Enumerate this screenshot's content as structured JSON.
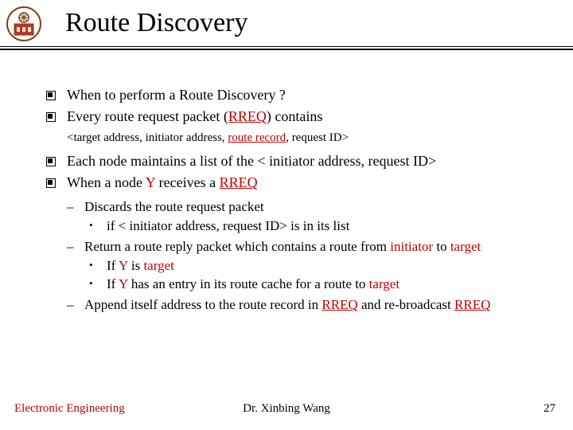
{
  "title": "Route Discovery",
  "bullets": {
    "b1": "When to perform a Route Discovery ?",
    "b2_pre": "Every route request packet (",
    "b2_rreq": "RREQ",
    "b2_post": ") contains",
    "b2_sub_pre": "<target address, initiator address, ",
    "b2_sub_rr": "route record",
    "b2_sub_post": ", request ID>",
    "b3": "Each node maintains a list of the < initiator address,  request ID>",
    "b4_pre": "When a node ",
    "b4_y": "Y",
    "b4_mid": " receives a ",
    "b4_rreq": "RREQ"
  },
  "dash": {
    "d1": "Discards the route request packet",
    "d1_dot": "if < initiator address,  request ID> is in its list",
    "d2_pre": "Return a route reply packet which contains a route from ",
    "d2_init": "initiator",
    "d2_mid": " to ",
    "d2_tgt": "target",
    "d2_dot1_pre": "If  ",
    "d2_dot1_y": "Y",
    "d2_dot1_post": " is ",
    "d2_dot1_tgt": "target",
    "d2_dot2_pre": "If ",
    "d2_dot2_y": "Y",
    "d2_dot2_mid": " has an entry in its route cache for a route to ",
    "d2_dot2_tgt": "target",
    "d3_pre": "Append itself address to the route record in ",
    "d3_r1": "RREQ",
    "d3_mid": " and re-broadcast ",
    "d3_r2": "RREQ"
  },
  "footer": {
    "left": "Electronic Engineering",
    "center": "Dr. Xinbing Wang",
    "right": "27"
  }
}
